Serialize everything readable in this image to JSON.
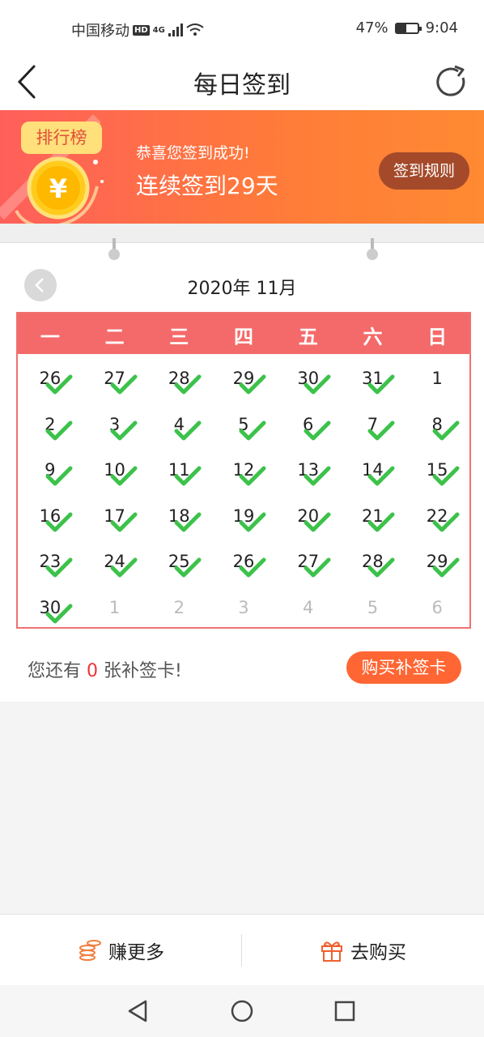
{
  "status": {
    "carrier": "中国移动",
    "hd": "HD",
    "network": "4G",
    "battery_percent": "47%",
    "battery_level": 0.47,
    "time": "9:04"
  },
  "nav": {
    "title": "每日签到"
  },
  "banner": {
    "rank_label": "排行榜",
    "coin_symbol": "¥",
    "subtitle": "恭喜您签到成功!",
    "streak_text": "连续签到29天",
    "rules_label": "签到规则"
  },
  "calendar": {
    "month_title": "2020年 11月",
    "weekdays": [
      "一",
      "二",
      "三",
      "四",
      "五",
      "六",
      "日"
    ],
    "days": [
      {
        "d": "26",
        "cur": false,
        "checked": true
      },
      {
        "d": "27",
        "cur": false,
        "checked": true
      },
      {
        "d": "28",
        "cur": false,
        "checked": true
      },
      {
        "d": "29",
        "cur": false,
        "checked": true
      },
      {
        "d": "30",
        "cur": false,
        "checked": true
      },
      {
        "d": "31",
        "cur": false,
        "checked": true
      },
      {
        "d": "1",
        "cur": true,
        "checked": false
      },
      {
        "d": "2",
        "cur": true,
        "checked": true
      },
      {
        "d": "3",
        "cur": true,
        "checked": true
      },
      {
        "d": "4",
        "cur": true,
        "checked": true
      },
      {
        "d": "5",
        "cur": true,
        "checked": true
      },
      {
        "d": "6",
        "cur": true,
        "checked": true
      },
      {
        "d": "7",
        "cur": true,
        "checked": true
      },
      {
        "d": "8",
        "cur": true,
        "checked": true
      },
      {
        "d": "9",
        "cur": true,
        "checked": true
      },
      {
        "d": "10",
        "cur": true,
        "checked": true
      },
      {
        "d": "11",
        "cur": true,
        "checked": true
      },
      {
        "d": "12",
        "cur": true,
        "checked": true
      },
      {
        "d": "13",
        "cur": true,
        "checked": true
      },
      {
        "d": "14",
        "cur": true,
        "checked": true
      },
      {
        "d": "15",
        "cur": true,
        "checked": true
      },
      {
        "d": "16",
        "cur": true,
        "checked": true
      },
      {
        "d": "17",
        "cur": true,
        "checked": true
      },
      {
        "d": "18",
        "cur": true,
        "checked": true
      },
      {
        "d": "19",
        "cur": true,
        "checked": true
      },
      {
        "d": "20",
        "cur": true,
        "checked": true
      },
      {
        "d": "21",
        "cur": true,
        "checked": true
      },
      {
        "d": "22",
        "cur": true,
        "checked": true
      },
      {
        "d": "23",
        "cur": true,
        "checked": true
      },
      {
        "d": "24",
        "cur": true,
        "checked": true
      },
      {
        "d": "25",
        "cur": true,
        "checked": true
      },
      {
        "d": "26",
        "cur": true,
        "checked": true
      },
      {
        "d": "27",
        "cur": true,
        "checked": true
      },
      {
        "d": "28",
        "cur": true,
        "checked": true
      },
      {
        "d": "29",
        "cur": true,
        "checked": true
      },
      {
        "d": "30",
        "cur": true,
        "checked": true
      },
      {
        "d": "1",
        "cur": false,
        "checked": false
      },
      {
        "d": "2",
        "cur": false,
        "checked": false
      },
      {
        "d": "3",
        "cur": false,
        "checked": false
      },
      {
        "d": "4",
        "cur": false,
        "checked": false
      },
      {
        "d": "5",
        "cur": false,
        "checked": false
      },
      {
        "d": "6",
        "cur": false,
        "checked": false
      }
    ]
  },
  "makeup": {
    "prefix": "您还有 ",
    "count": "0",
    "suffix": " 张补签卡!",
    "buy_label": "购买补签卡"
  },
  "tabs": {
    "earn_more": "赚更多",
    "go_buy": "去购买"
  },
  "colors": {
    "accent": "#ff6633",
    "calendar_header": "#f46a6a",
    "check": "#3cc24a"
  }
}
